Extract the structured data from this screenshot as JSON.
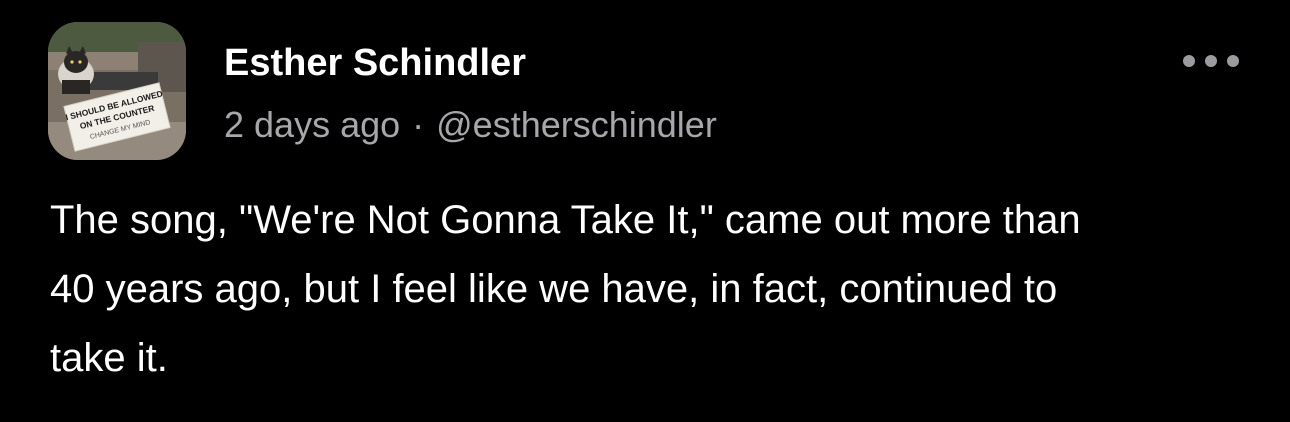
{
  "post": {
    "author": {
      "display_name": "Esther Schindler",
      "handle": "@estherschindler",
      "avatar_sign_lines": [
        "I SHOULD BE ALLOWED",
        "ON THE COUNTER",
        "CHANGE MY MIND"
      ]
    },
    "timestamp": "2 days ago",
    "separator": "·",
    "more_icon": "more-horizontal-icon",
    "text_lines": [
      "The song, \"We're Not Gonna Take It,\" came out more than",
      "40 years ago, but I feel like we have, in fact, continued to",
      "take it."
    ]
  },
  "colors": {
    "background": "#000000",
    "primary_text": "#ffffff",
    "secondary_text": "#a6a6ab",
    "icon": "#9b9ba0"
  }
}
